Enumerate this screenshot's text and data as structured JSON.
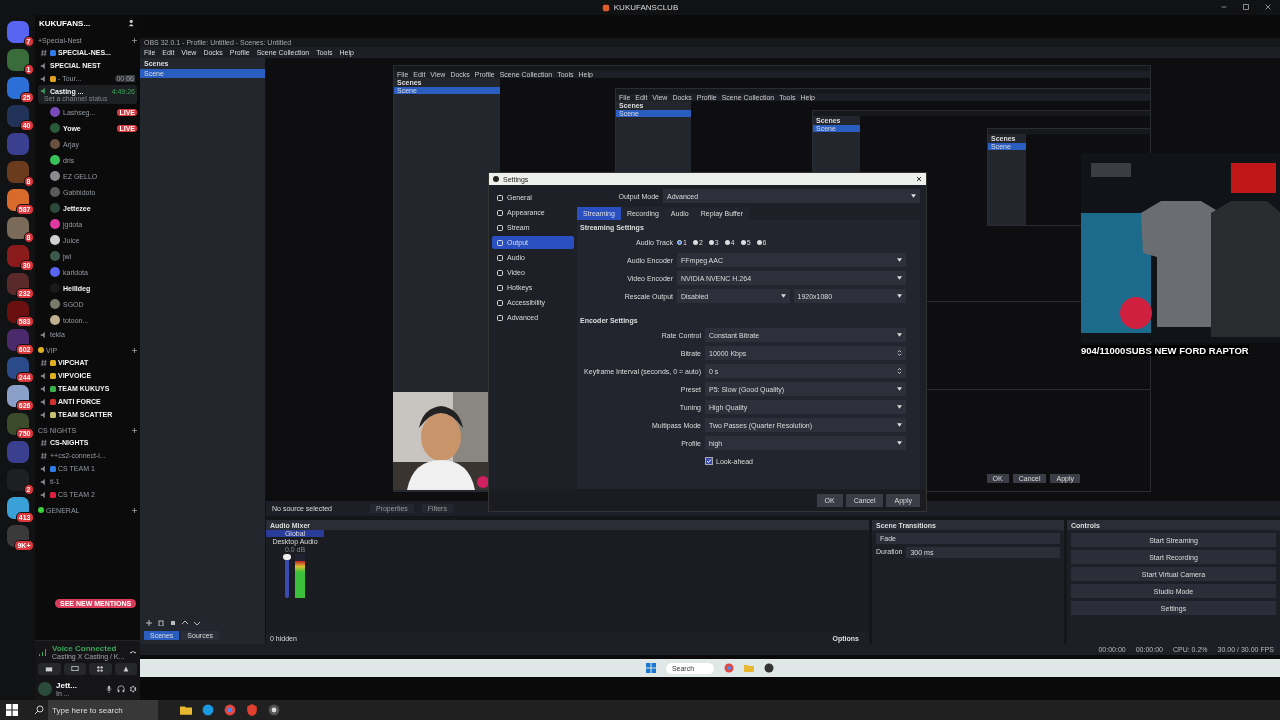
{
  "top_bar": {
    "title": "KUKUFANSCLUB"
  },
  "discord": {
    "servers": [
      {
        "badge": "7",
        "color": "#5865f2"
      },
      {
        "badge": "1",
        "color": "#3a6b3a"
      },
      {
        "badge": "25",
        "color": "#2c6fd6"
      },
      {
        "badge": "40",
        "color": "#22335a"
      },
      {
        "color": "#3b3f8f"
      },
      {
        "badge": "8",
        "color": "#6b3b1d"
      },
      {
        "badge": "587",
        "color": "#d86a2a"
      },
      {
        "badge": "8",
        "color": "#7a6a5a"
      },
      {
        "badge": "30",
        "color": "#8b1a1a"
      },
      {
        "badge": "232",
        "color": "#5a2a2a"
      },
      {
        "badge": "583",
        "color": "#6a1010"
      },
      {
        "badge": "602",
        "color": "#4a2a6a"
      },
      {
        "badge": "244",
        "color": "#2a4a8a"
      },
      {
        "badge": "626",
        "color": "#8aa0c8"
      },
      {
        "badge": "750",
        "color": "#3a4a2a"
      },
      {
        "color": "#3b3f8f"
      },
      {
        "badge": "2",
        "color": "#1e1f22"
      },
      {
        "badge": "413",
        "color": "#3aa0d8"
      },
      {
        "badge": "9K+",
        "color": "#3a3a3a"
      }
    ],
    "server_name": "KUKUFANS...",
    "channels": [
      {
        "kind": "category",
        "name": "+Special-Nest",
        "bold": false
      },
      {
        "kind": "text",
        "name": "SPECIAL-NES...",
        "bold": true,
        "color": "#2f7be8"
      },
      {
        "kind": "voice",
        "name": "SPECIAL NEST",
        "bold": true
      },
      {
        "kind": "voice",
        "name": "- Tour...",
        "bold": false,
        "color": "#e0a020",
        "limit": [
          "00",
          "06"
        ]
      },
      {
        "kind": "voice",
        "name": "Casting ...",
        "bold": true,
        "selected": true,
        "timer": "4:49:26",
        "status": "Set a channel status",
        "children": [
          {
            "name": "Lashseg...",
            "bold": false,
            "badge": "LIVE",
            "color": "#7a4ab8"
          },
          {
            "name": "Yowe",
            "bold": true,
            "badge": "LIVE",
            "color": "#2a5a3a"
          },
          {
            "name": "Arjay",
            "bold": false,
            "color": "#6a5040"
          },
          {
            "name": "dris",
            "bold": false,
            "color": "#3ac05a"
          },
          {
            "name": "EZ GELLO",
            "bold": false,
            "color": "#8a8a90"
          },
          {
            "name": "Gabbidoto",
            "bold": false,
            "color": "#5a5a5a"
          },
          {
            "name": "Jettezee",
            "bold": true,
            "color": "#2a4a3a"
          },
          {
            "name": "jgdota",
            "bold": false,
            "color": "#e03aa0"
          },
          {
            "name": "Juice",
            "bold": false,
            "color": "#d0d0d0"
          },
          {
            "name": "jwl",
            "bold": false,
            "color": "#3a5a4a"
          },
          {
            "name": "karldota",
            "bold": false,
            "color": "#5865f2"
          },
          {
            "name": "Heilldeg",
            "bold": true,
            "color": "#1a1a1a"
          },
          {
            "name": "SGOD",
            "bold": false,
            "color": "#7a7a6a"
          },
          {
            "name": "totoon...",
            "bold": false,
            "color": "#c0b090"
          }
        ]
      },
      {
        "kind": "voice",
        "name": "tekla",
        "bold": false
      },
      {
        "kind": "category",
        "name": "VIP",
        "bold": false,
        "color": "#e0b020"
      },
      {
        "kind": "text",
        "name": "VIPCHAT",
        "bold": true,
        "color": "#e0b020"
      },
      {
        "kind": "voice",
        "name": "VIPVOICE",
        "bold": true,
        "color": "#e0b020"
      },
      {
        "kind": "voice",
        "name": "TEAM KUKUYS",
        "bold": true,
        "color": "#3ab04a"
      },
      {
        "kind": "voice",
        "name": "ANTI FORCE",
        "bold": true,
        "color": "#d03030"
      },
      {
        "kind": "voice",
        "name": "TEAM SCATTER",
        "bold": true,
        "color": "#c8c070"
      },
      {
        "kind": "category",
        "name": "CS NIGHTS",
        "bold": false
      },
      {
        "kind": "text",
        "name": "CS-NIGHTS",
        "bold": true
      },
      {
        "kind": "text",
        "name": "++cs2-connect-i...",
        "bold": false
      },
      {
        "kind": "voice",
        "name": "CS TEAM 1",
        "bold": false,
        "color": "#2f7be8"
      },
      {
        "kind": "voice",
        "name": "ti-1",
        "bold": false
      },
      {
        "kind": "voice",
        "name": "CS TEAM 2",
        "bold": false,
        "color": "#e02040"
      },
      {
        "kind": "category",
        "name": "GENERAL",
        "bold": false,
        "color": "#3ad03a"
      }
    ],
    "mentions_pill": "SEE NEW MENTIONS",
    "voice": {
      "status": "Voice Connected",
      "channel": "Casting X Casting / K..."
    },
    "user": {
      "name": "Jett...",
      "status": "In ..."
    }
  },
  "obs": {
    "title": "OBS 32.0.1 - Profile: Untitled - Scenes: Untitled",
    "nested": [
      {
        "title": "Scenes",
        "scene": "Scene",
        "menu": [
          "File",
          "Edit",
          "View",
          "Docks",
          "Profile",
          "Scene Collection",
          "Tools",
          "Help"
        ],
        "buttons": [
          "OK",
          "Cancel",
          "Apply"
        ]
      },
      {
        "title": "Scenes",
        "scene": "Scene",
        "menu": [
          "File",
          "Edit",
          "View",
          "Docks",
          "Profile",
          "Scene Collection",
          "Tools",
          "Help"
        ]
      },
      {
        "title": "Scenes",
        "scene": "Scene"
      },
      {
        "title": "Scenes",
        "scene": "Scene"
      }
    ],
    "menu": [
      "File",
      "Edit",
      "View",
      "Docks",
      "Profile",
      "Scene Collection",
      "Tools",
      "Help"
    ],
    "scenes_title": "Scenes",
    "scenes": [
      {
        "name": "Scene",
        "selected": true
      }
    ],
    "overlay_text": "904/11000SUBS NEW FORD RAPTOR",
    "settings": {
      "title": "Settings",
      "nav": [
        {
          "label": "General",
          "selected": false
        },
        {
          "label": "Appearance",
          "selected": false
        },
        {
          "label": "Stream",
          "selected": false
        },
        {
          "label": "Output",
          "selected": true
        },
        {
          "label": "Audio",
          "selected": false
        },
        {
          "label": "Video",
          "selected": false
        },
        {
          "label": "Hotkeys",
          "selected": false
        },
        {
          "label": "Accessibility",
          "selected": false
        },
        {
          "label": "Advanced",
          "selected": false
        }
      ],
      "output_mode_label": "Output Mode",
      "output_mode": "Advanced",
      "tabs": [
        {
          "label": "Streaming",
          "selected": true
        },
        {
          "label": "Recording",
          "selected": false
        },
        {
          "label": "Audio",
          "selected": false
        },
        {
          "label": "Replay Buffer",
          "selected": false
        }
      ],
      "streaming_title": "Streaming Settings",
      "audio_track_label": "Audio Track",
      "tracks": [
        {
          "label": "1",
          "selected": true
        },
        {
          "label": "2",
          "selected": false
        },
        {
          "label": "3",
          "selected": false
        },
        {
          "label": "4",
          "selected": false
        },
        {
          "label": "5",
          "selected": false
        },
        {
          "label": "6",
          "selected": false
        }
      ],
      "streaming_rows": [
        {
          "label": "Audio Encoder",
          "value": "FFmpeg AAC"
        },
        {
          "label": "Video Encoder",
          "value": "NVIDIA NVENC H.264"
        }
      ],
      "rescale": {
        "label": "Rescale Output",
        "value": "Disabled",
        "resolution": "1920x1080"
      },
      "encoder_title": "Encoder Settings",
      "encoder_rows": [
        {
          "kind": "select",
          "label": "Rate Control",
          "value": "Constant Bitrate"
        },
        {
          "kind": "spin",
          "label": "Bitrate",
          "value": "10000 Kbps"
        },
        {
          "kind": "spin",
          "label": "Keyframe Interval (seconds, 0 = auto)",
          "value": "0 s"
        },
        {
          "kind": "select",
          "label": "Preset",
          "value": "P5: Slow (Good Quality)"
        },
        {
          "kind": "select",
          "label": "Tuning",
          "value": "High Quality"
        },
        {
          "kind": "select",
          "label": "Multipass Mode",
          "value": "Two Passes (Quarter Resolution)"
        },
        {
          "kind": "select",
          "label": "Profile",
          "value": "high"
        }
      ],
      "checkboxes": [
        {
          "label": "Look-ahead",
          "checked": true
        }
      ],
      "buttons": [
        "OK",
        "Cancel",
        "Apply"
      ]
    },
    "source_bar": {
      "text": "No source selected",
      "buttons": [
        "Properties",
        "Filters"
      ]
    },
    "dock_tabs": [
      {
        "label": "Scenes",
        "selected": true
      },
      {
        "label": "Sources",
        "selected": false
      }
    ],
    "mixer": {
      "title": "Audio Mixer",
      "global": "Global",
      "channel": "Desktop Audio",
      "reading": "0.0 dB",
      "level": 1,
      "meter": {
        "level": 0.85
      },
      "hidden": "0 hidden",
      "options": "Options"
    },
    "transitions": {
      "title": "Scene Transitions",
      "value": "Fade",
      "duration_label": "Duration",
      "duration": "300 ms"
    },
    "controls": {
      "title": "Controls",
      "buttons": [
        "Start Streaming",
        "Start Recording",
        "Start Virtual Camera",
        "Studio Mode",
        "Settings"
      ]
    },
    "status": {
      "stream_time": "00:00:00",
      "record_time": "00:00:00",
      "cpu": "CPU: 0.2%",
      "fps": "30.00 / 30.00 FPS"
    },
    "inner_taskbar": {
      "search": "Search"
    }
  },
  "taskbar": {
    "search_placeholder": "Type here to search"
  }
}
